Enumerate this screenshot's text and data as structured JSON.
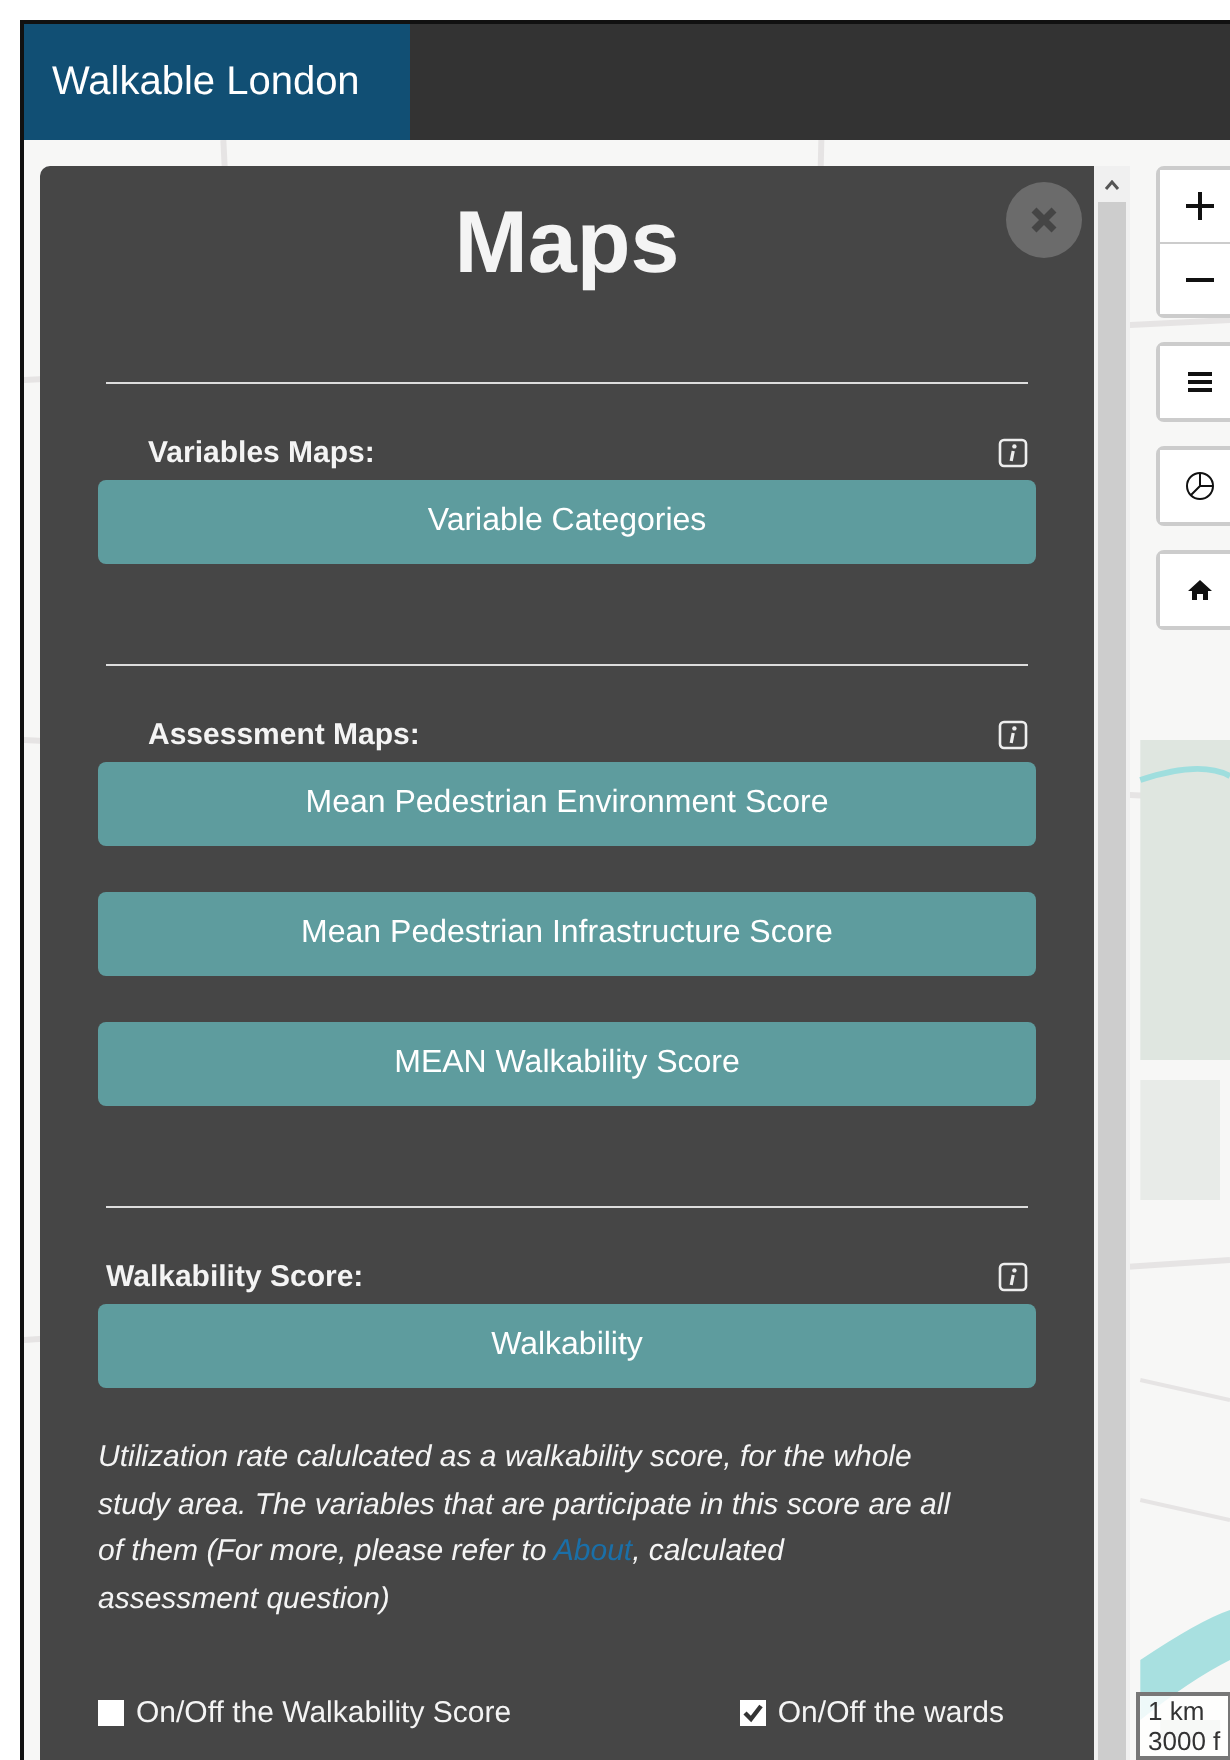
{
  "header": {
    "brand": "Walkable London"
  },
  "panel": {
    "title": "Maps",
    "sections": [
      {
        "label": "Variables Maps:",
        "buttons": [
          "Variable Categories"
        ]
      },
      {
        "label": "Assessment Maps:",
        "buttons": [
          "Mean Pedestrian Environment Score",
          "Mean Pedestrian Infrastructure Score",
          "MEAN Walkability Score"
        ]
      },
      {
        "label": "Walkability Score:",
        "buttons": [
          "Walkability"
        ]
      }
    ],
    "description": {
      "before": "Utilization rate calulcated as a walkability score, for the whole study area. The variables that are participate in this score are all of them (For more, please refer to ",
      "link": "About",
      "after": ", calculated assessment question)"
    },
    "toggles": [
      {
        "label": "On/Off the Walkability Score",
        "checked": false
      },
      {
        "label": "On/Off the wards",
        "checked": true
      }
    ]
  },
  "scale": [
    "1 km",
    "3000 f"
  ]
}
